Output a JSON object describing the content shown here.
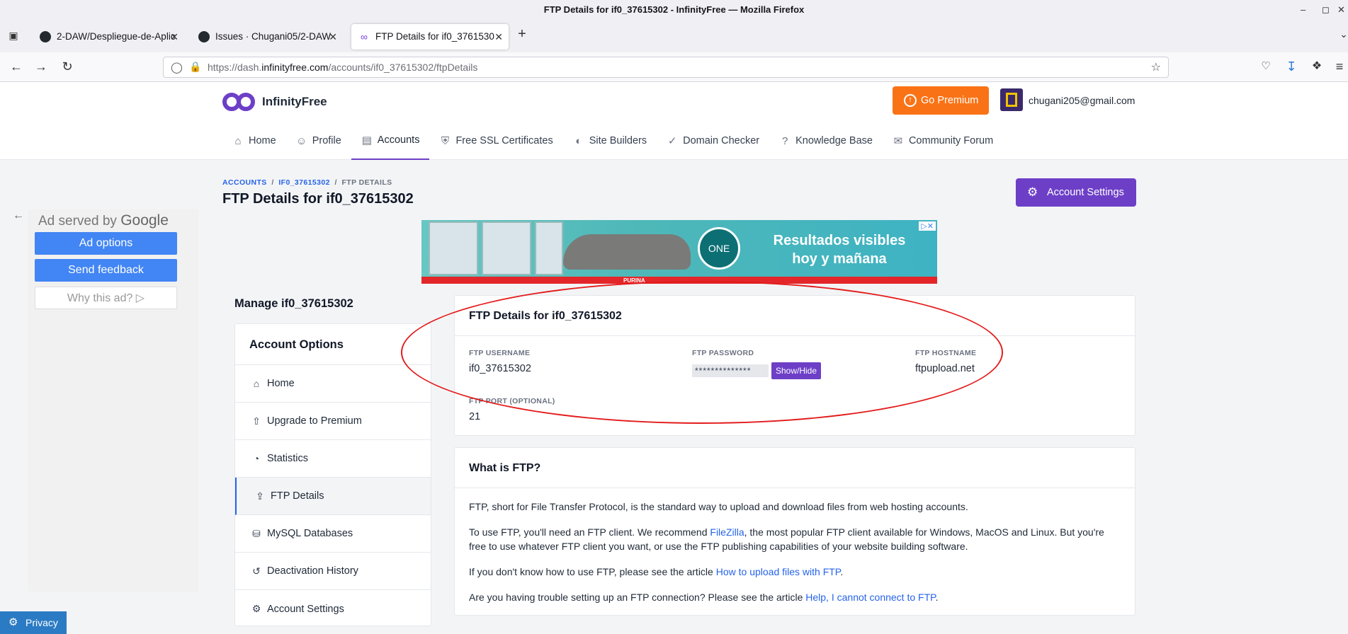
{
  "window": {
    "title": "FTP Details for if0_37615302 - InfinityFree — Mozilla Firefox"
  },
  "tabs": [
    {
      "label": "2-DAW/Despliegue-de-Aplic",
      "icon": "github-icon"
    },
    {
      "label": "Issues · Chugani05/2-DAW",
      "icon": "github-icon"
    },
    {
      "label": "FTP Details for if0_3761530",
      "icon": "infinity-icon",
      "active": true
    }
  ],
  "urlbar": {
    "prefix": "https://dash.",
    "domain": "infinityfree.com",
    "path": "/accounts/if0_37615302/ftpDetails"
  },
  "site": {
    "brand": "InfinityFree",
    "brand_color": "#6d3fc7",
    "go_premium": "Go Premium",
    "user_email": "chugani205@gmail.com",
    "nav": [
      {
        "label": "Home",
        "icon": "home-icon"
      },
      {
        "label": "Profile",
        "icon": "user-icon"
      },
      {
        "label": "Accounts",
        "icon": "server-icon",
        "active": true
      },
      {
        "label": "Free SSL Certificates",
        "icon": "shield-icon"
      },
      {
        "label": "Site Builders",
        "icon": "palette-icon"
      },
      {
        "label": "Domain Checker",
        "icon": "check-circle-icon"
      },
      {
        "label": "Knowledge Base",
        "icon": "help-icon"
      },
      {
        "label": "Community Forum",
        "icon": "chat-icon"
      }
    ]
  },
  "ad": {
    "served_by": "Ad served by",
    "google": "Google",
    "options": "Ad options",
    "feedback": "Send feedback",
    "why": "Why this ad? ▷",
    "banner_text": "Resultados visibles hoy y mañana",
    "banner_brand": "PURINA",
    "banner_product": "ONE"
  },
  "breadcrumb": {
    "accounts": "ACCOUNTS",
    "account": "IF0_37615302",
    "current": "FTP DETAILS",
    "sep": "/"
  },
  "page": {
    "title": "FTP Details for if0_37615302",
    "account_settings": "Account Settings"
  },
  "sidebar": {
    "manage": "Manage if0_37615302",
    "header": "Account Options",
    "items": [
      {
        "label": "Home",
        "icon": "home-icon"
      },
      {
        "label": "Upgrade to Premium",
        "icon": "upgrade-icon"
      },
      {
        "label": "Statistics",
        "icon": "pie-chart-icon"
      },
      {
        "label": "FTP Details",
        "icon": "upload-file-icon",
        "active": true
      },
      {
        "label": "MySQL Databases",
        "icon": "database-icon"
      },
      {
        "label": "Deactivation History",
        "icon": "history-icon"
      },
      {
        "label": "Account Settings",
        "icon": "gear-icon"
      }
    ]
  },
  "ftp": {
    "title": "FTP Details for if0_37615302",
    "username_label": "FTP USERNAME",
    "username": "if0_37615302",
    "password_label": "FTP PASSWORD",
    "password_mask": "**************",
    "show_hide": "Show/Hide",
    "hostname_label": "FTP HOSTNAME",
    "hostname": "ftpupload.net",
    "port_label": "FTP PORT (OPTIONAL)",
    "port": "21"
  },
  "what": {
    "title": "What is FTP?",
    "p1": "FTP, short for File Transfer Protocol, is the standard way to upload and download files from web hosting accounts.",
    "p2_a": "To use FTP, you'll need an FTP client. We recommend ",
    "p2_link": "FileZilla",
    "p2_b": ", the most popular FTP client available for Windows, MacOS and Linux. But you're free to use whatever FTP client you want, or use the FTP publishing capabilities of your website building software.",
    "p3_a": "If you don't know how to use FTP, please see the article ",
    "p3_link": "How to upload files with FTP",
    "p3_b": ".",
    "p4_a": "Are you having trouble setting up an FTP connection? Please see the article ",
    "p4_link": "Help, I cannot connect to FTP",
    "p4_b": "."
  },
  "privacy": "Privacy",
  "annotation_color": "#e31b1b"
}
